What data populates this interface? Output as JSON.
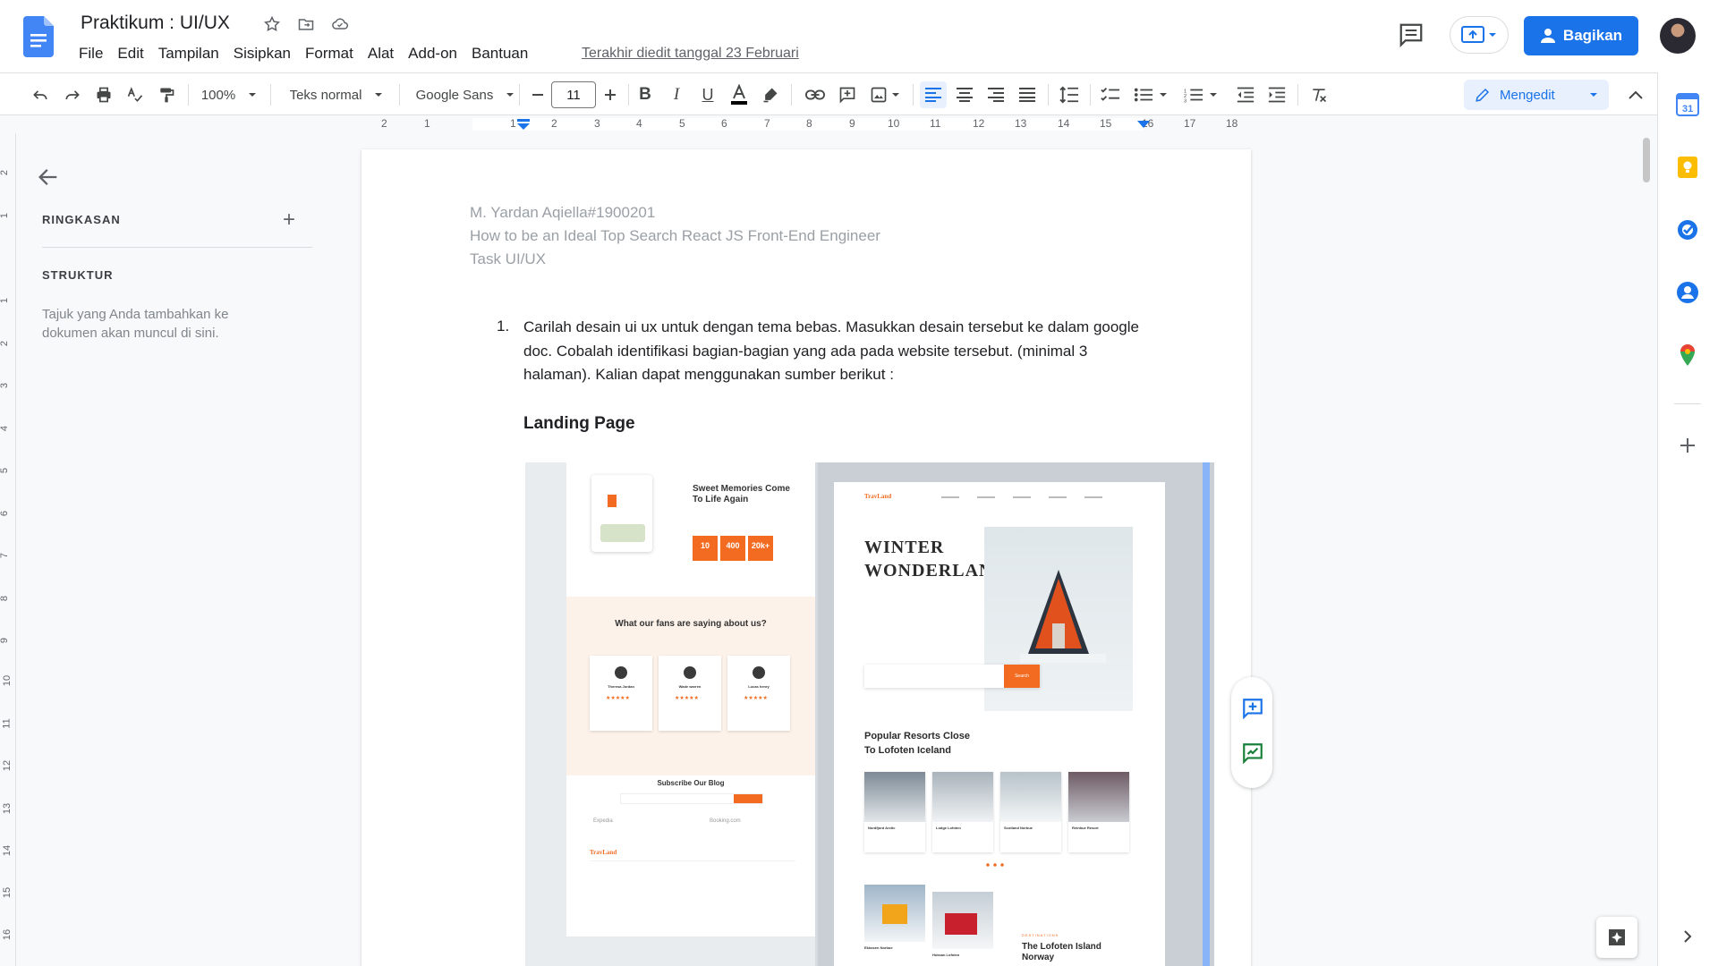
{
  "header": {
    "doc_title": "Praktikum : UI/UX",
    "menu": [
      "File",
      "Edit",
      "Tampilan",
      "Sisipkan",
      "Format",
      "Alat",
      "Add-on",
      "Bantuan"
    ],
    "last_edit": "Terakhir diedit tanggal 23 Februari",
    "share_label": "Bagikan"
  },
  "toolbar": {
    "zoom": "100%",
    "style": "Teks normal",
    "font": "Google Sans",
    "font_size": "11",
    "mode": "Mengedit"
  },
  "ruler": {
    "labels": [
      "2",
      "1",
      "1",
      "2",
      "3",
      "4",
      "5",
      "6",
      "7",
      "8",
      "9",
      "10",
      "11",
      "12",
      "13",
      "14",
      "15",
      "16",
      "17",
      "18"
    ]
  },
  "vruler": {
    "labels": [
      "2",
      "1",
      "1",
      "2",
      "3",
      "4",
      "5",
      "6",
      "7",
      "8",
      "9",
      "10",
      "11",
      "12",
      "13",
      "14",
      "15",
      "16"
    ]
  },
  "outline": {
    "summary": "RINGKASAN",
    "structure": "STRUKTUR",
    "hint": "Tajuk yang Anda tambahkan ke dokumen akan muncul di sini."
  },
  "document": {
    "header_lines": [
      "M. Yardan Aqiella#1900201",
      "How to be an Ideal Top Search React JS Front-End Engineer",
      "Task UI/UX"
    ],
    "list_number": "1.",
    "paragraph": "Carilah desain ui ux untuk dengan tema bebas. Masukkan desain tersebut ke dalam google doc. Cobalah identifikasi bagian-bagian yang ada pada website tersebut. (minimal 3 halaman). Kalian dapat menggunakan sumber berikut :",
    "heading": "Landing Page"
  },
  "embedded_image": {
    "left_card": {
      "memories_title": "Sweet Memories Come To Life Again",
      "stats": [
        "10",
        "400",
        "20k+"
      ],
      "fans_title": "What our fans are saying about us?",
      "reviewers": [
        "Theresa Jordan",
        "Wade warren",
        "Lucas henry"
      ],
      "subscribe": "Subscribe Our Blog",
      "brands": [
        "Expedia",
        "Booking.com"
      ],
      "brand_logo": "TravLand"
    },
    "right_card": {
      "brand_logo": "TravLand",
      "hero_title_1": "WINTER",
      "hero_title_2": "WONDERLAND",
      "search": "Search",
      "popular_title_1": "Popular Resorts Close",
      "popular_title_2": "To Lofoten Iceland",
      "resorts": [
        "Nordfjord Arctic",
        "Lodge Lofoten",
        "Scotland Norbue",
        "Reinbue Resort"
      ],
      "bottom_cards": [
        "Ekkosen Norbue",
        "Hoksan Lofoten"
      ],
      "destination_label": "DESTINATIONS",
      "destination_title": "The Lofoten Island Norway"
    }
  },
  "colors": {
    "accent": "#1a73e8",
    "orange": "#f26b21"
  }
}
